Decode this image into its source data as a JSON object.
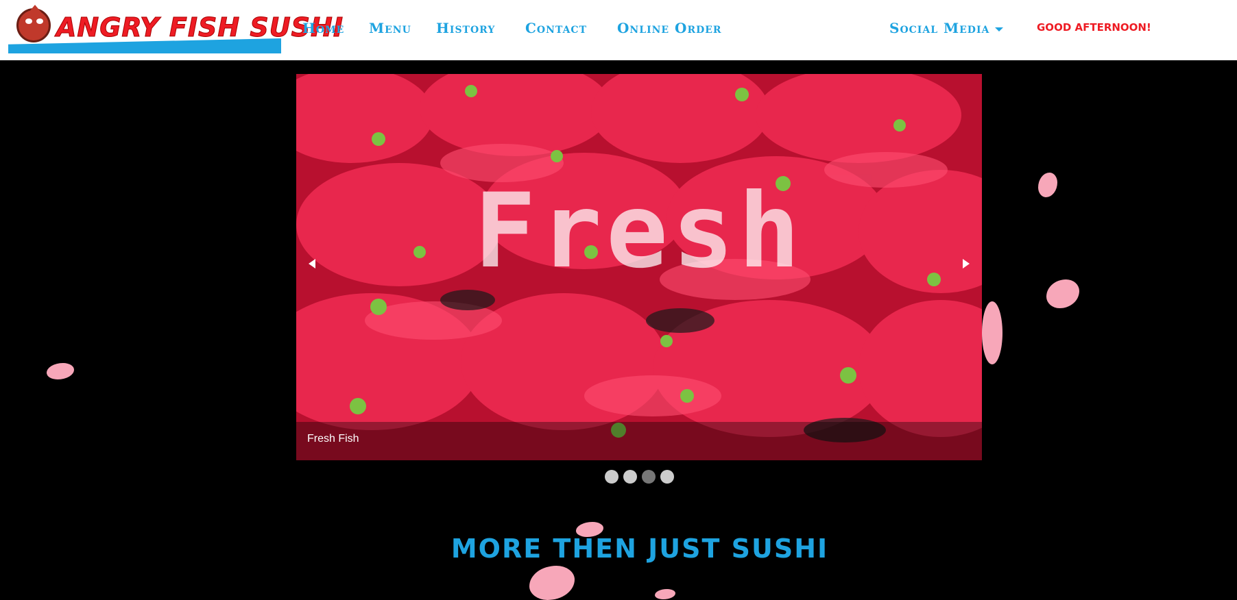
{
  "brand": {
    "name": "ANGRY FISH SUSHI"
  },
  "nav": {
    "links": [
      "Home",
      "Menu",
      "History",
      "Contact",
      "Online Order"
    ],
    "social_media": "Social Media",
    "greeting": "GOOD AFTERNOON!"
  },
  "carousel": {
    "overlay_word": "Fresh",
    "caption": "Fresh Fish",
    "slide_count": 4,
    "active_index": 2
  },
  "section": {
    "headline": "MORE THEN JUST SUSHI"
  },
  "colors": {
    "accent_blue": "#1ea3e0",
    "brand_red": "#ee1c24",
    "background": "#000000"
  },
  "icons": [
    "angry-fish-logo-icon",
    "carousel-prev-icon",
    "carousel-next-icon",
    "chevron-down-icon",
    "cherry-blossom-petal-icon"
  ]
}
